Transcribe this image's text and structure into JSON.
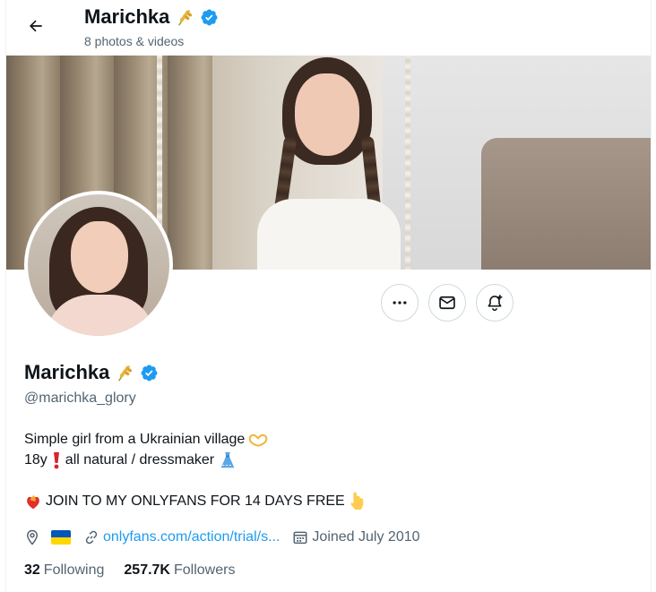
{
  "header": {
    "title": "Marichka",
    "subtitle": "8 photos & videos",
    "back_icon": "arrow-left-icon",
    "title_emoji": "wheat-emoji",
    "verified_icon": "verified-badge-icon"
  },
  "actions": {
    "more_icon": "ellipsis-icon",
    "message_icon": "envelope-icon",
    "notify_icon": "bell-plus-icon"
  },
  "profile": {
    "name": "Marichka",
    "handle": "@marichka_glory",
    "bio": {
      "line1": "Simple girl from a Ukrainian village",
      "line2_prefix": "18y",
      "line2_suffix": "all natural / dressmaker",
      "line3": "JOIN TO MY ONLYFANS FOR 14 DAYS FREE"
    },
    "meta": {
      "location_icon": "location-pin-icon",
      "location_flag": "ukraine-flag",
      "link_text": "onlyfans.com/action/trial/s...",
      "joined_text": "Joined July 2010"
    },
    "stats": {
      "following_count": "32",
      "following_label": "Following",
      "followers_count": "257.7K",
      "followers_label": "Followers"
    }
  },
  "colors": {
    "accent": "#1d9bf0",
    "text_primary": "#0f1419",
    "text_secondary": "#536471",
    "border": "#cfd9de",
    "flag_blue": "#0057b7",
    "flag_yellow": "#ffd700"
  }
}
